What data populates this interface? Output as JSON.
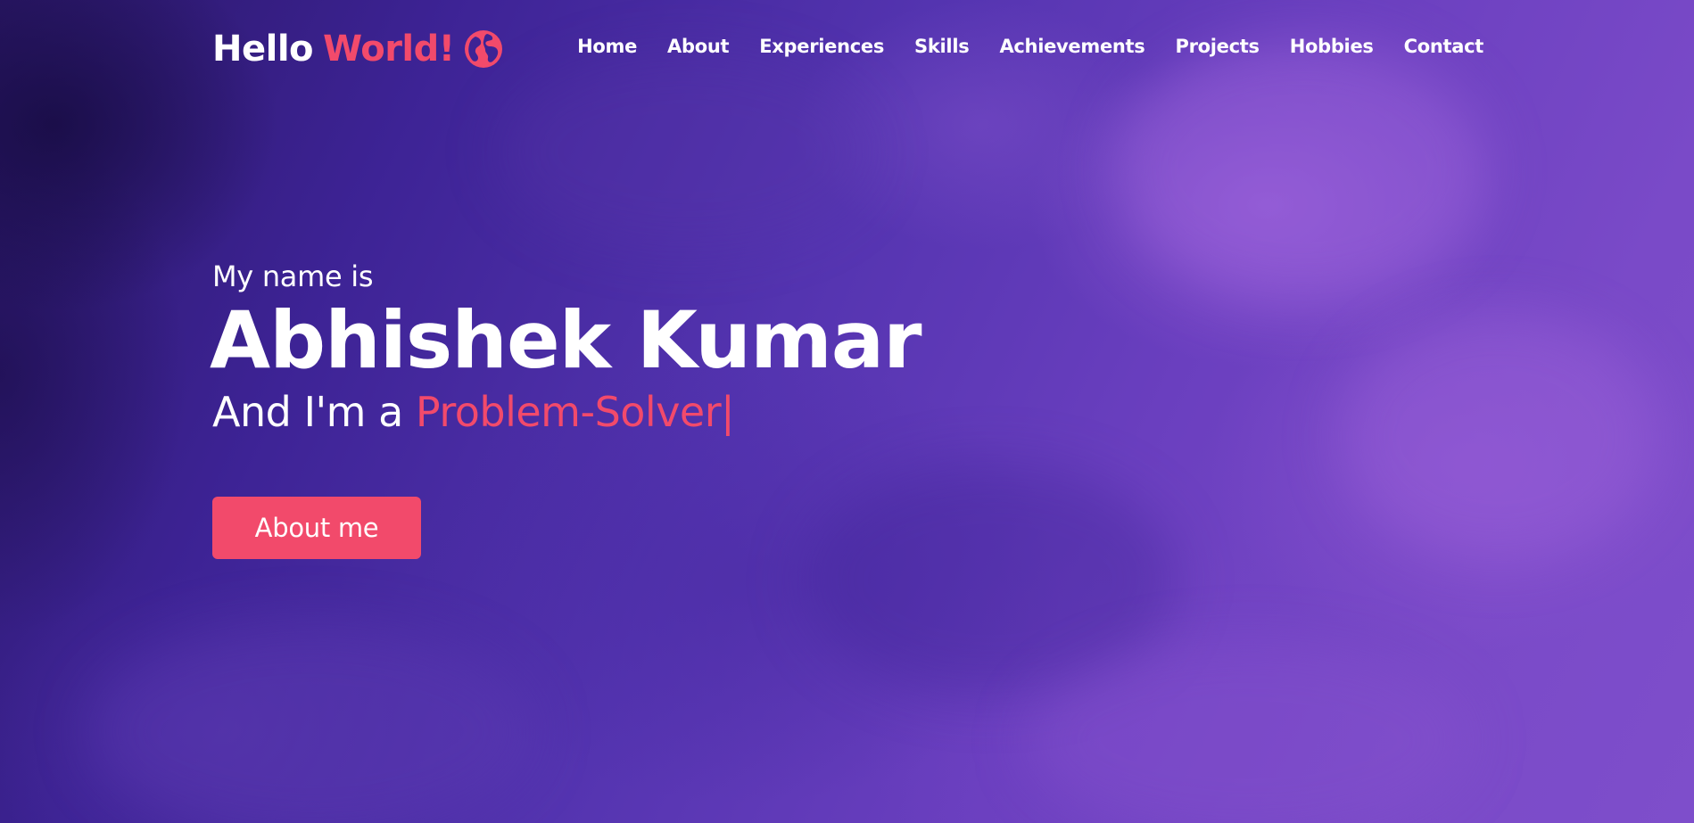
{
  "logo": {
    "prefix": "Hello",
    "accent": "World!",
    "icon": "globe-icon"
  },
  "nav": {
    "items": [
      {
        "label": "Home"
      },
      {
        "label": "About"
      },
      {
        "label": "Experiences"
      },
      {
        "label": "Skills"
      },
      {
        "label": "Achievements"
      },
      {
        "label": "Projects"
      },
      {
        "label": "Hobbies"
      },
      {
        "label": "Contact"
      }
    ]
  },
  "hero": {
    "intro": "My name is",
    "name": "Abhishek Kumar",
    "role_prefix": "And I'm a",
    "role_typed": "Problem-Solver",
    "cursor": "|",
    "button_label": "About me"
  },
  "colors": {
    "accent": "#f24a6b",
    "background_dark": "#2a1767",
    "background_light": "#7e4ecb",
    "text": "#ffffff"
  }
}
